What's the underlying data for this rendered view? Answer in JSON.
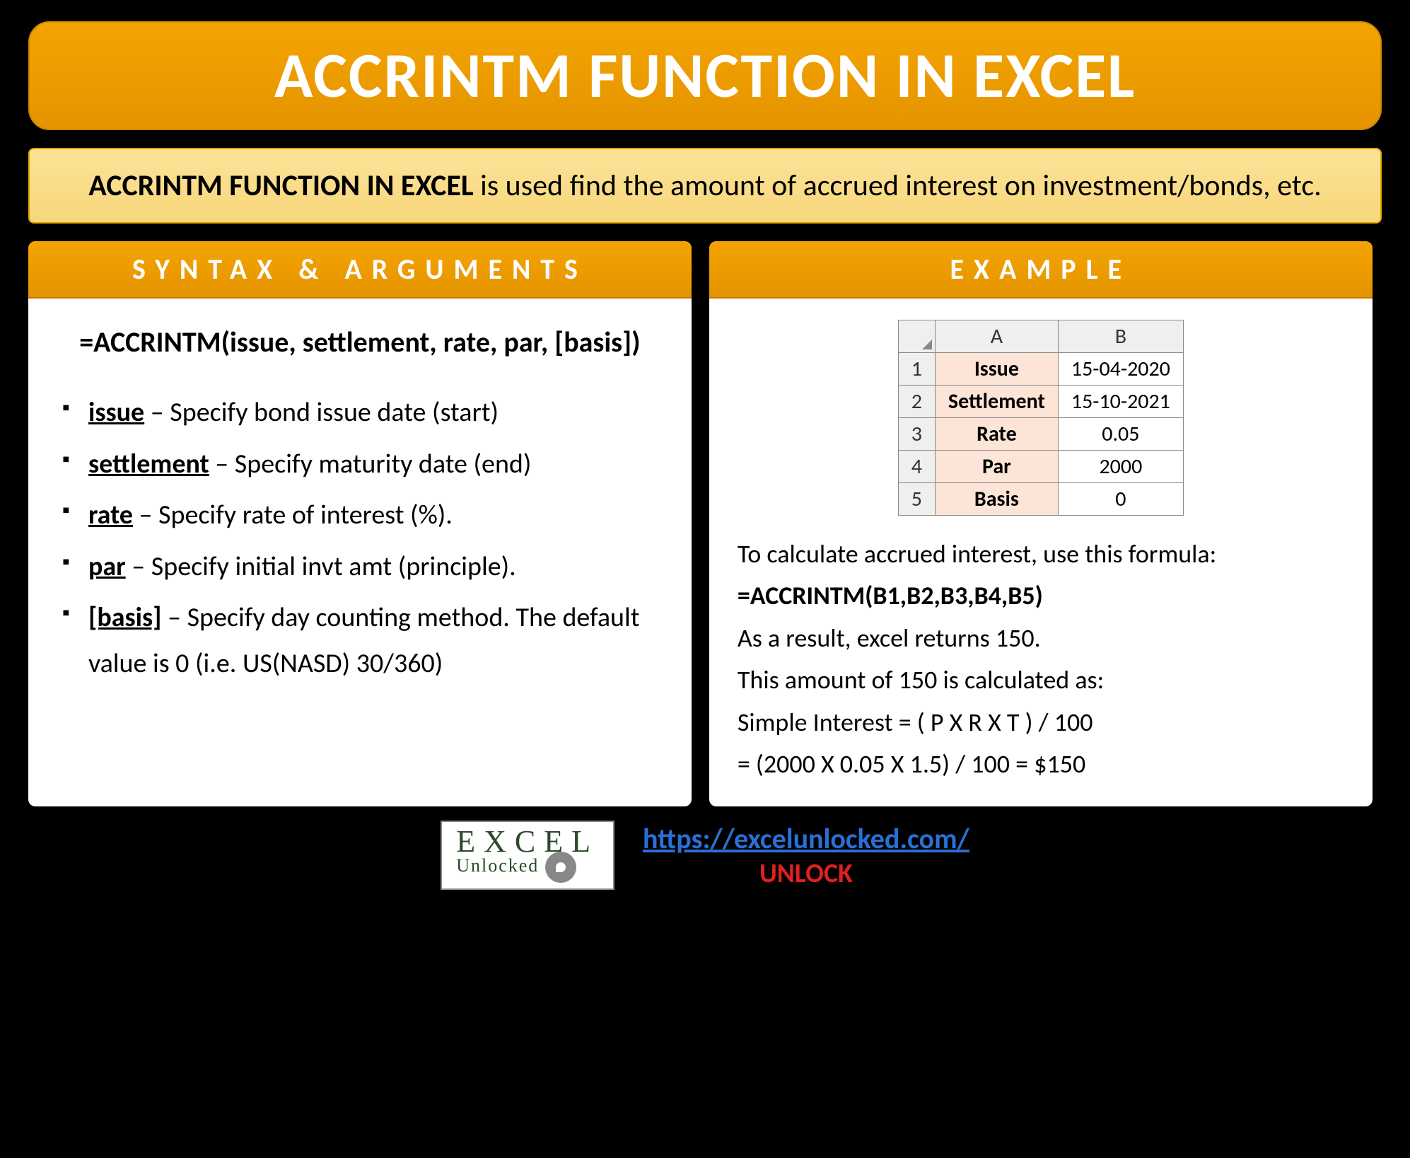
{
  "title": "ACCRINTM FUNCTION IN EXCEL",
  "description_bold": "ACCRINTM FUNCTION IN EXCEL",
  "description_rest": " is used find the amount of accrued interest on investment/bonds, etc.",
  "syntax": {
    "header": "SYNTAX & ARGUMENTS",
    "formula": "=ACCRINTM(issue, settlement, rate, par, [basis])",
    "args": [
      {
        "name": "issue",
        "desc": " – Specify bond issue date (start)"
      },
      {
        "name": "settlement",
        "desc": " – Specify maturity date (end)"
      },
      {
        "name": "rate",
        "desc": " – Specify rate of interest (%)."
      },
      {
        "name": "par",
        "desc": " – Specify initial invt amt (principle)."
      },
      {
        "name": "[basis]",
        "desc": " – Specify day counting method. The default value is 0 (i.e. US(NASD) 30/360)"
      }
    ]
  },
  "example": {
    "header": "EXAMPLE",
    "table": {
      "colA": "A",
      "colB": "B",
      "rows": [
        {
          "n": "1",
          "label": "Issue",
          "value": "15-04-2020"
        },
        {
          "n": "2",
          "label": "Settlement",
          "value": "15-10-2021"
        },
        {
          "n": "3",
          "label": "Rate",
          "value": "0.05"
        },
        {
          "n": "4",
          "label": "Par",
          "value": "2000"
        },
        {
          "n": "5",
          "label": "Basis",
          "value": "0"
        }
      ]
    },
    "lines": {
      "intro": "To calculate accrued interest, use this formula:",
      "formula": "=ACCRINTM(B1,B2,B3,B4,B5)",
      "result": "As a result, excel returns 150.",
      "calc_intro": "This amount of 150 is calculated as:",
      "calc_formula": "Simple Interest = ( P X R X T ) / 100",
      "calc_numbers": "= (2000 X 0.05 X 1.5) / 100 = $150"
    }
  },
  "footer": {
    "logo_main": "EXCEL",
    "logo_sub": "Unlocked",
    "url": "https://excelunlocked.com/",
    "unlock": "UNLOCK"
  }
}
